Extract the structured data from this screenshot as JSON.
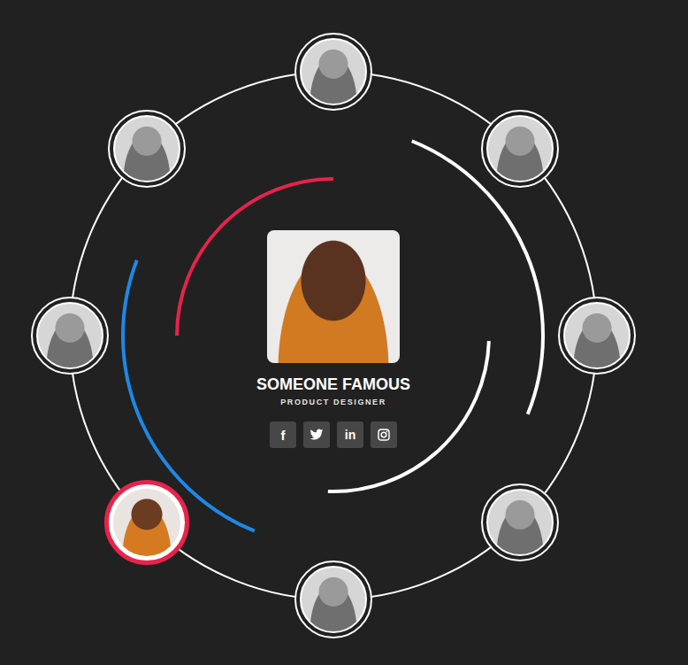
{
  "profile": {
    "name": "SOMEONE FAMOUS",
    "role": "PRODUCT DESIGNER"
  },
  "socials": [
    {
      "kind": "facebook",
      "glyph": "f"
    },
    {
      "kind": "twitter"
    },
    {
      "kind": "linkedin",
      "glyph": "in"
    },
    {
      "kind": "instagram"
    }
  ],
  "team": [
    {
      "selected": false
    },
    {
      "selected": false
    },
    {
      "selected": false
    },
    {
      "selected": false
    },
    {
      "selected": false
    },
    {
      "selected": true
    },
    {
      "selected": false
    },
    {
      "selected": false
    }
  ]
}
